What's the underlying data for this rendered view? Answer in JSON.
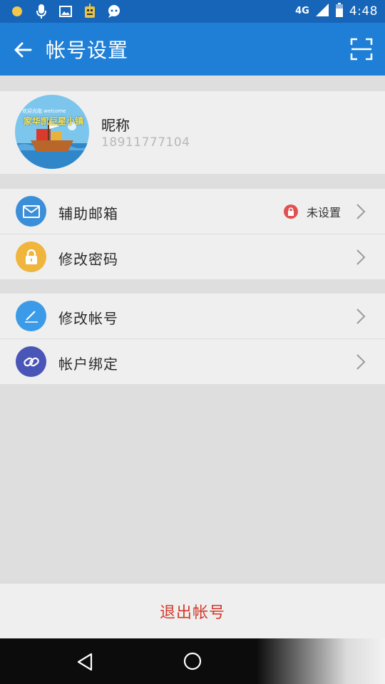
{
  "status_bar": {
    "network": "4G",
    "time": "4:48",
    "icons": [
      "notification-dot-icon",
      "microphone-icon",
      "image-icon",
      "app-robot-icon",
      "chat-bubble-icon",
      "signal-icon",
      "battery-icon"
    ]
  },
  "app_bar": {
    "title": "帐号设置",
    "back_icon": "arrow-left-icon",
    "scan_icon": "scan-frame-icon"
  },
  "profile": {
    "nickname": "昵称",
    "phone": "18911777104",
    "avatar_caption": "家华凯巨星小镇",
    "avatar_small_text": "欢迎光临 welcome"
  },
  "menu_group_1": [
    {
      "label": "辅助邮箱",
      "icon": "mail-icon",
      "icon_color": "#3b8fd9",
      "status": "未设置",
      "status_icon": "lock-icon"
    },
    {
      "label": "修改密码",
      "icon": "lock-icon",
      "icon_color": "#f0b53d"
    }
  ],
  "menu_group_2": [
    {
      "label": "修改帐号",
      "icon": "edit-icon",
      "icon_color": "#3b9be8"
    },
    {
      "label": "帐户绑定",
      "icon": "link-icon",
      "icon_color": "#4a55b8"
    }
  ],
  "logout": {
    "label": "退出帐号",
    "color": "#d23a2b"
  },
  "colors": {
    "primary": "#1f7fd7",
    "status_bar": "#1665b8",
    "background": "#dedede",
    "card": "#efefef"
  }
}
